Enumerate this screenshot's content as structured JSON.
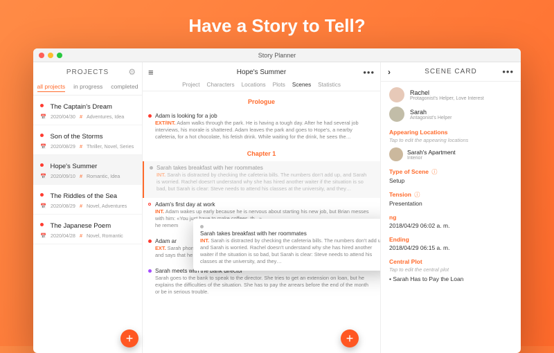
{
  "hero": {
    "headline": "Have a Story to Tell?"
  },
  "titlebar": {
    "title": "Story Planner"
  },
  "projects_panel": {
    "title": "PROJECTS",
    "tabs": [
      "all projects",
      "in progress",
      "completed"
    ],
    "active_tab": 0,
    "items": [
      {
        "title": "The Captain's Dream",
        "date": "2020/04/30",
        "tags": "Adventures, Idea"
      },
      {
        "title": "Son of the Storms",
        "date": "2020/08/29",
        "tags": "Thriller, Novel, Series"
      },
      {
        "title": "Hope's Summer",
        "date": "2020/09/10",
        "tags": "Romantic, Idea",
        "selected": true
      },
      {
        "title": "The Riddles of the Sea",
        "date": "2020/08/29",
        "tags": "Novel, Adventures"
      },
      {
        "title": "The Japanese Poem",
        "date": "2020/04/28",
        "tags": "Novel, Romantic"
      }
    ]
  },
  "detail_panel": {
    "title": "Hope's Summer",
    "tabs": [
      "Project",
      "Characters",
      "Locations",
      "Plots",
      "Scenes",
      "Statistics"
    ],
    "active_tab_index": 4,
    "chapters": [
      {
        "label": "Prologue"
      },
      {
        "label": "Chapter 1"
      }
    ],
    "scenes": {
      "prolog": {
        "title": "Adam is looking for a job",
        "slug": "EXT/INT.",
        "body": "Adam walks through the park. He is having a tough day. After he had several job interviews, his morale is shattered. Adam leaves the park and goes to Hope's, a nearby cafeteria, for a hot chocolate, his fetish drink. While waiting for the drink, he sees the…"
      },
      "c1_a": {
        "title": "Sarah takes breakfast with her roommates",
        "slug": "INT.",
        "body": "Sarah is distracted by checking the cafeteria bills. The numbers don't add up, and Sarah is worried. Rachel doesn't understand why she has hired another waiter if the situation is so bad, but Sarah is clear: Steve needs to attend his classes at the university, and they…"
      },
      "c1_b": {
        "title": "Adam's first day at work",
        "slug": "INT.",
        "body": "Adam wakes up early because he is nervous about starting his new job, but Brian messes with him: «You just have to make coffees, th...»",
        "body2": "he remem"
      },
      "c1_c": {
        "title": "Adam ar",
        "slug": "EXT.",
        "body": "Sarah phone with his father and explains that he has found a new job. He justifies himself and says that he won't stop drawing, but that…"
      },
      "c1_d": {
        "title": "Sarah meets with the bank director",
        "body": "Sarah goes to the bank to speak to the director. She tries to get an extension on loan, but he explains the difficulties of the situation. She has to pay the arrears before the end of the month or be in serious trouble."
      }
    },
    "drag_card": {
      "title": "Sarah takes breakfast with her roommates",
      "slug": "INT.",
      "body": "Sarah is distracted by checking the cafeteria bills. The numbers don't add up, and Sarah is worried. Rachel doesn't understand why she has hired another waiter if the situation is so bad, but Sarah is clear: Steve needs to attend his classes at the university, and they…"
    }
  },
  "scene_card": {
    "title": "SCENE CARD",
    "characters": [
      {
        "name": "Rachel",
        "role": "Protagonist's Helper, Love Interest"
      },
      {
        "name": "Sarah",
        "role": "Antagonist's Helper"
      }
    ],
    "locations_label": "Appearing Locations",
    "locations_hint": "Tap to edit the appearing locations",
    "location": {
      "name": "Sarah's Apartment",
      "sub": "Interior"
    },
    "type_label": "Type of Scene",
    "type_value": "Setup",
    "tension_label": "Tension",
    "tension_value": "Presentation",
    "beginning_label": "ng",
    "beginning_value": "2018/04/29 06:02 a. m.",
    "ending_label": "Ending",
    "ending_value": "2018/04/29 06:15 a. m.",
    "central_plot_label": "Central Plot",
    "central_plot_hint": "Tap to edit the central plot",
    "central_plot_value": "Sarah Has to Pay the Loan"
  },
  "icons": {
    "calendar": "📅",
    "hash": "#",
    "more": "•••",
    "plus": "+",
    "chevron": "›",
    "gear": "⚙",
    "menu": "≡",
    "info": "ⓘ"
  }
}
